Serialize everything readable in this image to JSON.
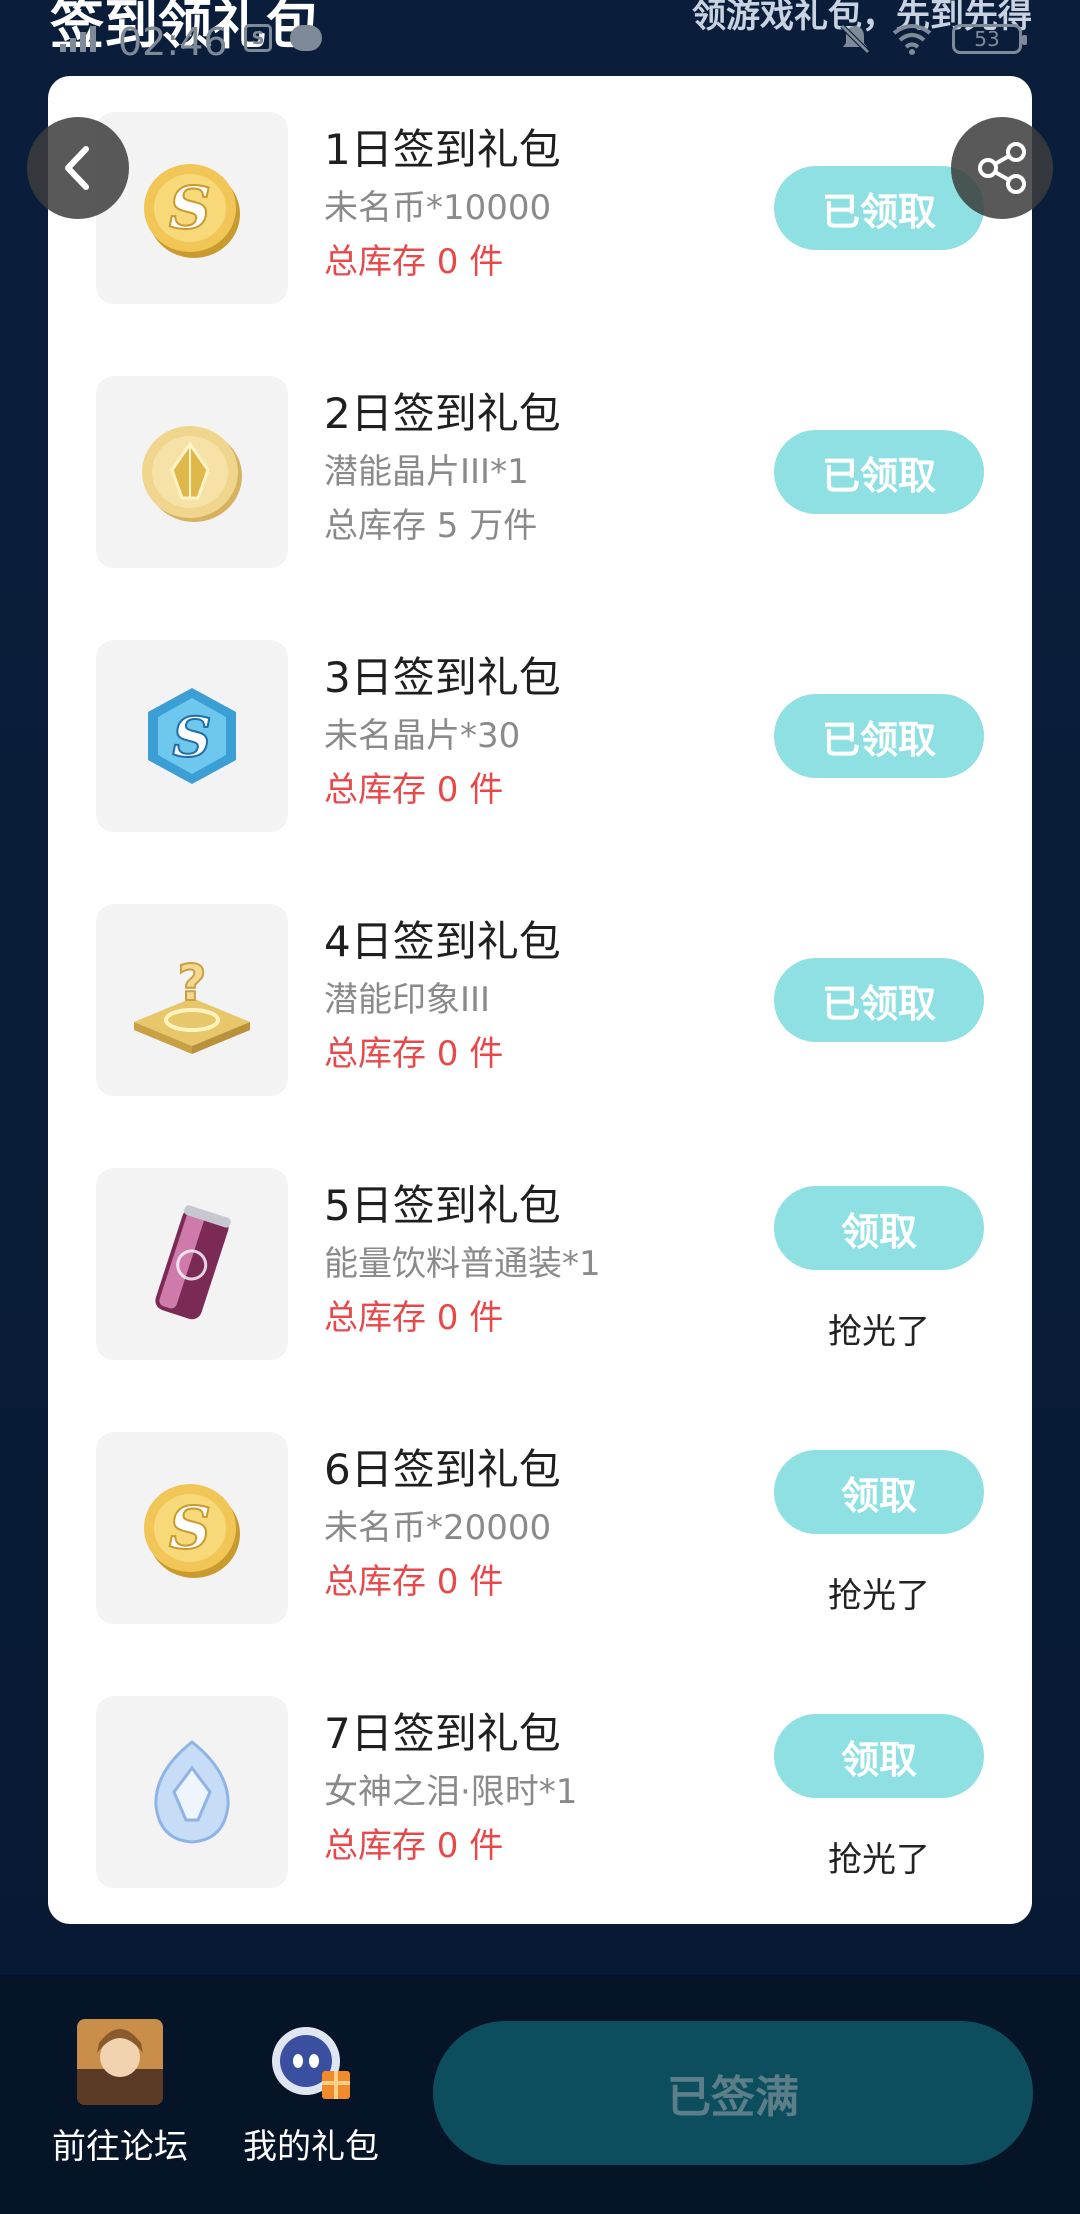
{
  "header": {
    "title": "签到领礼包",
    "subtitle": "领游戏礼包，先到先得"
  },
  "status_bar": {
    "time": "02:46",
    "battery": "53"
  },
  "colors": {
    "claim_button": "#8fe0e2",
    "stock_zero": "#e8484a",
    "signed_button": "#0d4e5e"
  },
  "items": [
    {
      "title": "1日签到礼包",
      "desc": "未名币*10000",
      "stock": "总库存 0 件",
      "button": "已领取",
      "sold_out": "",
      "icon": "gold-s-coin-icon"
    },
    {
      "title": "2日签到礼包",
      "desc": "潜能晶片III*1",
      "stock": "总库存 5 万件",
      "button": "已领取",
      "sold_out": "",
      "icon": "gold-crystal-coin-icon"
    },
    {
      "title": "3日签到礼包",
      "desc": "未名晶片*30",
      "stock": "总库存 0 件",
      "button": "已领取",
      "sold_out": "",
      "icon": "blue-hexagon-chip-icon"
    },
    {
      "title": "4日签到礼包",
      "desc": "潜能印象III",
      "stock": "总库存 0 件",
      "button": "已领取",
      "sold_out": "",
      "icon": "mystery-pedestal-icon"
    },
    {
      "title": "5日签到礼包",
      "desc": "能量饮料普通装*1",
      "stock": "总库存 0 件",
      "button": "领取",
      "sold_out": "抢光了",
      "icon": "energy-drink-can-icon"
    },
    {
      "title": "6日签到礼包",
      "desc": "未名币*20000",
      "stock": "总库存 0 件",
      "button": "领取",
      "sold_out": "抢光了",
      "icon": "gold-s-coin-icon"
    },
    {
      "title": "7日签到礼包",
      "desc": "女神之泪·限时*1",
      "stock": "总库存 0 件",
      "button": "领取",
      "sold_out": "抢光了",
      "icon": "crystal-tear-icon"
    }
  ],
  "bottom_bar": {
    "forum_label": "前往论坛",
    "gifts_label": "我的礼包",
    "signed_label": "已签满"
  }
}
